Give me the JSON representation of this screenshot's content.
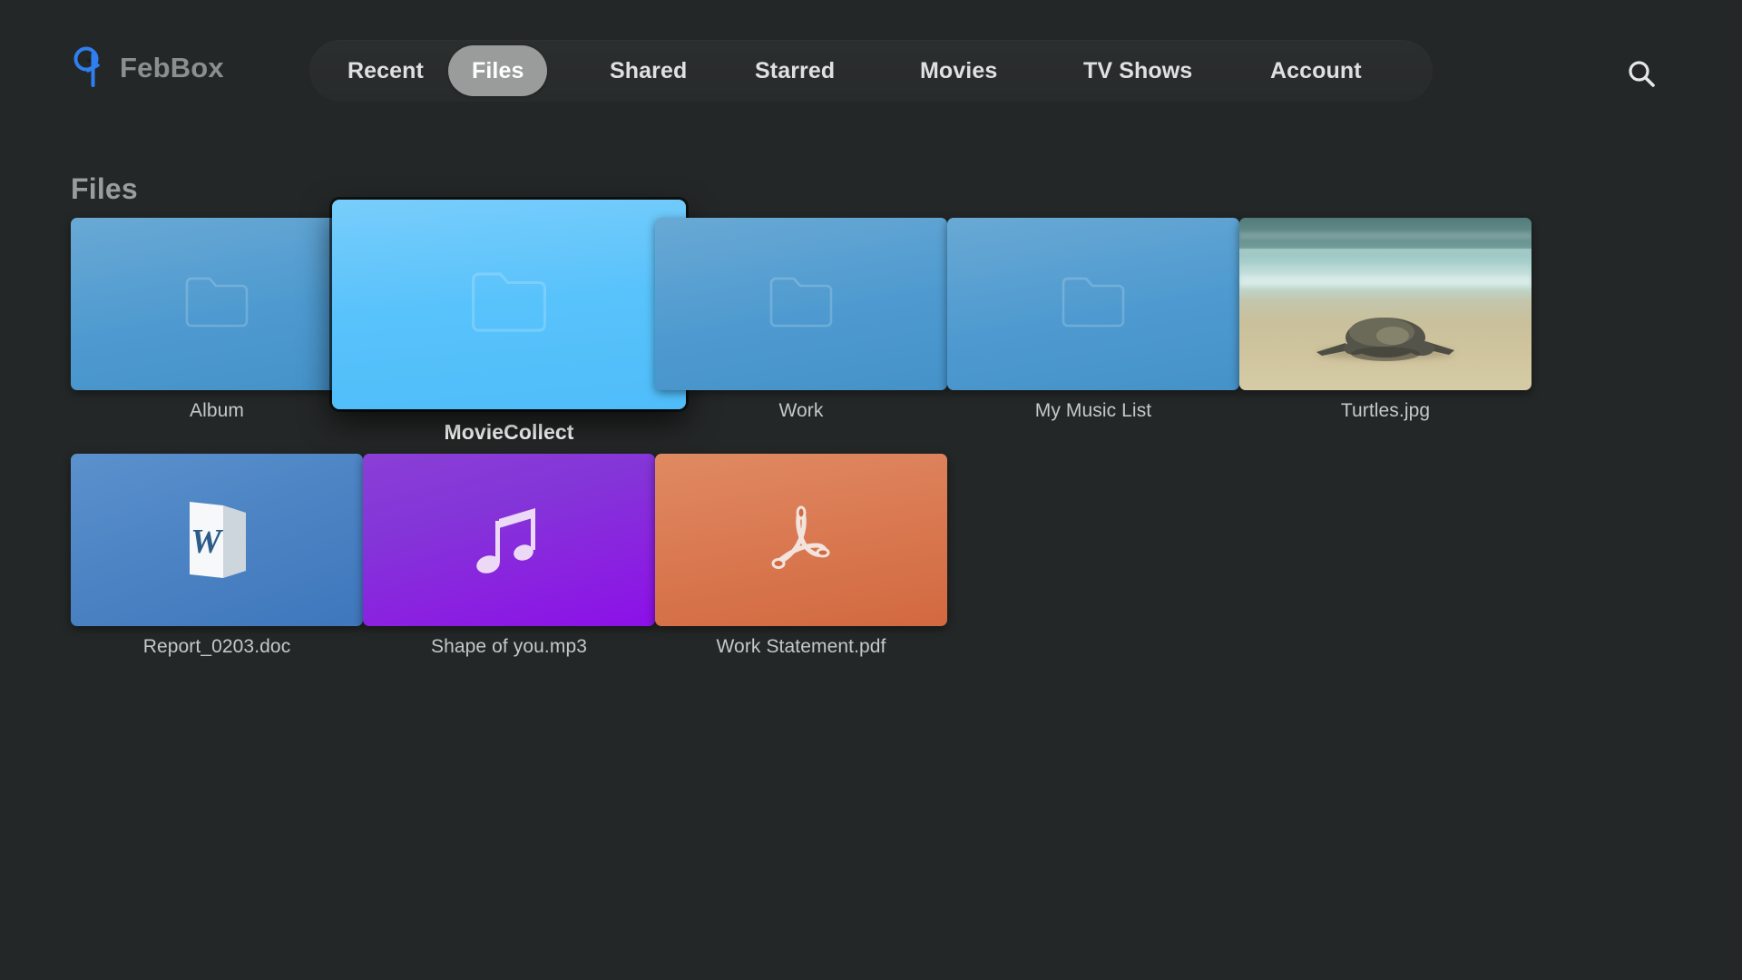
{
  "app": {
    "brand_name": "FebBox",
    "logo_icon": "febbox-logo-icon",
    "background_color": "#242727",
    "accent_color": "#2f7ff0"
  },
  "header": {
    "search_icon": "search-icon",
    "nav_tabs": [
      {
        "label": "Recent",
        "active": false
      },
      {
        "label": "Files",
        "active": true
      },
      {
        "label": "Shared",
        "active": false
      },
      {
        "label": "Starred",
        "active": false
      },
      {
        "label": "Movies",
        "active": false
      },
      {
        "label": "TV Shows",
        "active": false
      },
      {
        "label": "Account",
        "active": false
      }
    ]
  },
  "main": {
    "section_title": "Files",
    "items": [
      {
        "name": "Album",
        "kind": "folder",
        "icon": "folder-icon",
        "selected": false
      },
      {
        "name": "MovieCollect",
        "kind": "folder",
        "icon": "folder-icon",
        "selected": true
      },
      {
        "name": "Work",
        "kind": "folder",
        "icon": "folder-icon",
        "selected": false
      },
      {
        "name": "My Music List",
        "kind": "folder",
        "icon": "folder-icon",
        "selected": false
      },
      {
        "name": "Turtles.jpg",
        "kind": "image",
        "icon": "photo-thumbnail",
        "selected": false
      },
      {
        "name": "Report_0203.doc",
        "kind": "document",
        "icon": "word-document-icon",
        "selected": false
      },
      {
        "name": "Shape of you.mp3",
        "kind": "audio",
        "icon": "music-note-icon",
        "selected": false
      },
      {
        "name": "Work Statement.pdf",
        "kind": "pdf",
        "icon": "pdf-acrobat-icon",
        "selected": false
      }
    ]
  }
}
